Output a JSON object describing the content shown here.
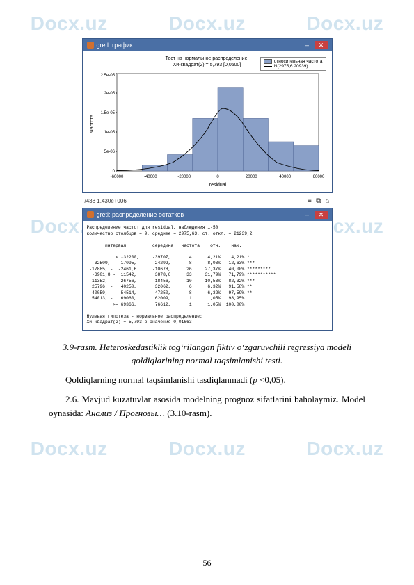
{
  "watermark": "Docx.uz",
  "chart_window": {
    "title": "gretl: график",
    "top_text_line1": "Тест на нормальное распределение:",
    "top_text_line2": "Хи-квадрат(2) = 5,793 [0,0500]",
    "legend": {
      "hist": "относительная частота",
      "curve": "N(2975,6 20939)"
    },
    "ylabel": "Частота",
    "xlabel": "residual"
  },
  "chart_data": {
    "type": "bar+line",
    "xlabel": "residual",
    "ylabel": "Частота",
    "xlim": [
      -60000,
      60000
    ],
    "ylim": [
      0,
      2.5e-05
    ],
    "xticks": [
      -60000,
      -40000,
      -20000,
      0,
      20000,
      40000,
      60000
    ],
    "yticks": [
      0,
      5e-06,
      1e-05,
      1.5e-05,
      2e-05,
      2.5e-05
    ],
    "ytick_labels": [
      "0",
      "5e-06",
      "1e-05",
      "1.5e-05",
      "2e-05",
      "2.5e-05"
    ],
    "bars": {
      "bin_edges": [
        -60000,
        -45000,
        -30000,
        -15000,
        0,
        15000,
        30000,
        45000,
        60000
      ],
      "heights": [
        0,
        1.5e-06,
        4.2e-06,
        1.35e-05,
        2.15e-05,
        1.35e-05,
        7.5e-06,
        6.5e-06,
        2e-06
      ]
    },
    "curve": {
      "type": "normal",
      "mean": 2975.6,
      "sd": 20939
    }
  },
  "toolbar": {
    "path": "/438 1.430e+006"
  },
  "text_window": {
    "title": "gretl: распределение остатков",
    "content_lines": [
      "Распределение частот для residual, наблюдения 1-50",
      "количество столбцов = 9, среднее = 2975,63, ст. откл. = 21239,2",
      "",
      "       интервал          середина   частота    отн.    нак.",
      "",
      "           < -32200,     -39707,       4      4,21%    4,21% *",
      "  -32509, - -17095,      -24292,       8      8,03%   12,63% ***",
      " -17885, -  -2461,6      -10678,      26     27,37%   40,00% *********",
      "  -3901,8 -  11542,       3878,6      33     31,79%   71,79% ***********",
      "  11352, -   26756,       18456,      10     10,53%   82,32% ***",
      "  25796, -   40250,       32062,       6      6,32%   91,58% **",
      "  40059, -   54514,       47250,       8      6,32%   97,59% **",
      "  54013, -   69060,       62009,       1      1,05%   98,95%",
      "          >= 69366,       76612,       1      1,05%  100,00%",
      "",
      "Нулевая гипотеза - нормальное распределение:",
      "Хи-квадрат(2) = 5,793 р-значение 0,01663"
    ]
  },
  "caption_line1": "3.9-rasm. Heteroskedastiklik togʻrilangan fiktiv oʻzgaruvchili regressiya modeli",
  "caption_line2": "qoldiqlarining normal taqsimlanishi testi.",
  "para1_a": "Qoldiqlarning normal taqsimlanishi tasdiqlanmadi (",
  "para1_b": "p",
  "para1_c": " <0,05).",
  "para2_a": "2.6. Mavjud kuzatuvlar asosida modelning prognoz sifatlarini baholaymiz. Model oynasida: ",
  "para2_b": "Анализ / Прогнозы…",
  "para2_c": " (3.10-rasm).",
  "page_number": "56"
}
